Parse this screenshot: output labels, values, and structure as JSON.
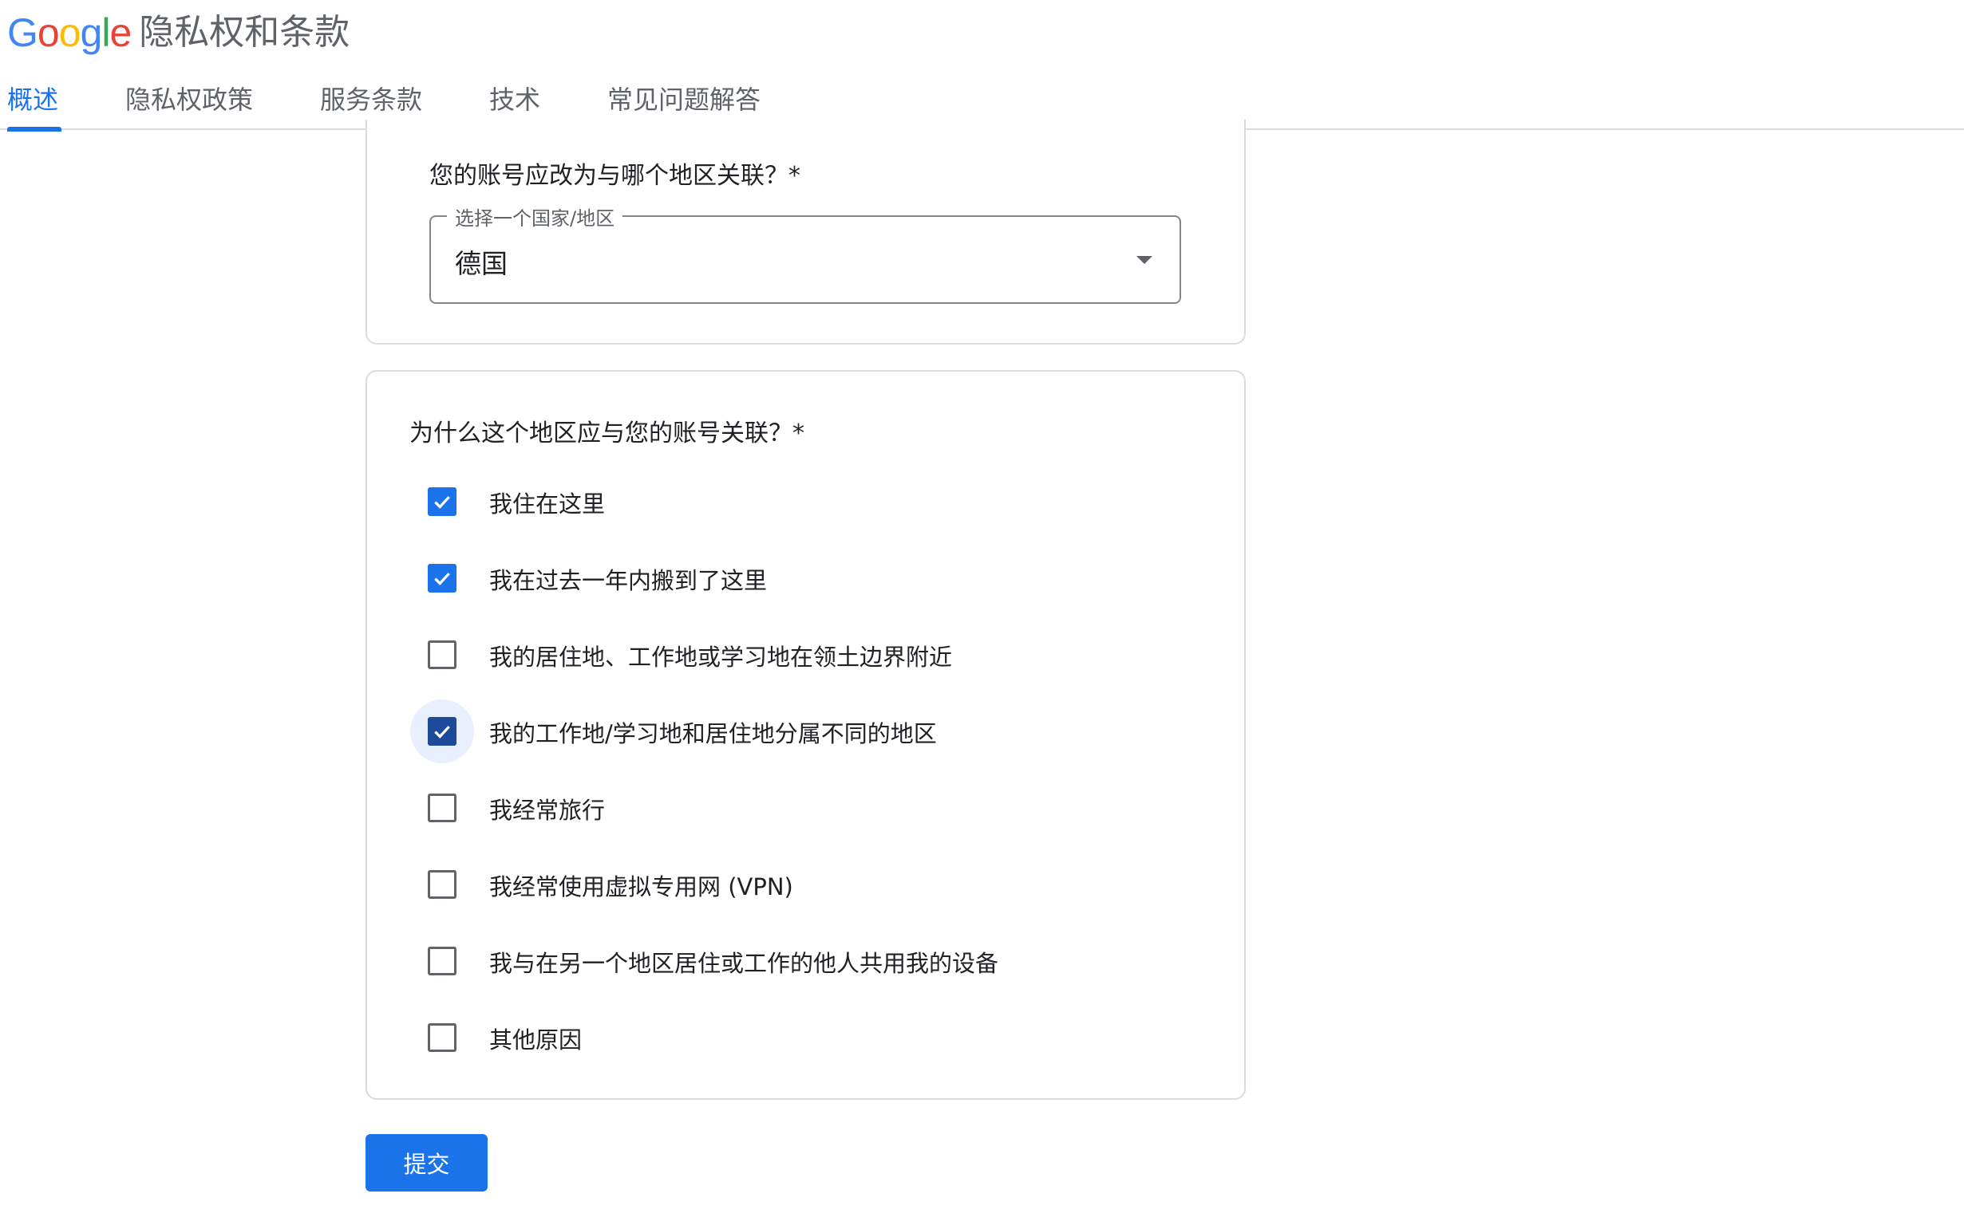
{
  "header": {
    "logo_letters": [
      {
        "char": "G",
        "color": "#4285F4"
      },
      {
        "char": "o",
        "color": "#EA4335"
      },
      {
        "char": "o",
        "color": "#FBBC05"
      },
      {
        "char": "g",
        "color": "#4285F4"
      },
      {
        "char": "l",
        "color": "#34A853"
      },
      {
        "char": "e",
        "color": "#EA4335"
      }
    ],
    "title": "隐私权和条款",
    "tabs": [
      {
        "label": "概述",
        "active": true
      },
      {
        "label": "隐私权政策",
        "active": false
      },
      {
        "label": "服务条款",
        "active": false
      },
      {
        "label": "技术",
        "active": false
      },
      {
        "label": "常见问题解答",
        "active": false
      }
    ]
  },
  "region_card": {
    "question": "您的账号应改为与哪个地区关联？*",
    "select": {
      "label": "选择一个国家/地区",
      "value": "德国",
      "icon": "arrow-drop-down-icon"
    }
  },
  "reasons_card": {
    "question": "为什么这个地区应与您的账号关联？*",
    "options": [
      {
        "label": "我住在这里",
        "checked": true
      },
      {
        "label": "我在过去一年内搬到了这里",
        "checked": true
      },
      {
        "label": "我的居住地、工作地或学习地在领土边界附近",
        "checked": false
      },
      {
        "label": "我的工作地/学习地和居住地分属不同的地区",
        "checked": true,
        "focused": true
      },
      {
        "label": "我经常旅行",
        "checked": false
      },
      {
        "label": "我经常使用虚拟专用网 (VPN)",
        "checked": false
      },
      {
        "label": "我与在另一个地区居住或工作的他人共用我的设备",
        "checked": false
      },
      {
        "label": "其他原因",
        "checked": false
      }
    ]
  },
  "submit_label": "提交",
  "colors": {
    "accent": "#1a73e8",
    "checkbox_focused": "#1d4a99",
    "focus_halo": "#e8f0fe",
    "border": "#dadce0"
  }
}
